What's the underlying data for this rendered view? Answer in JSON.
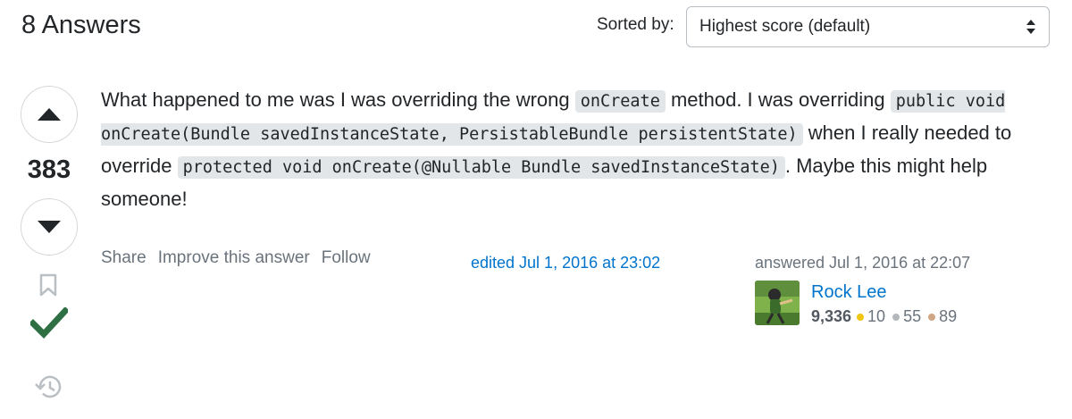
{
  "header": {
    "answers_title": "8 Answers",
    "sort_label": "Sorted by:",
    "sort_selected": "Highest score (default)"
  },
  "votes": {
    "score": "383"
  },
  "answer": {
    "t1": "What happened to me was I was overriding the wrong ",
    "c1": "onCreate",
    "t2": " method. I was overriding ",
    "c2": "public void onCreate(Bundle savedInstanceState, PersistableBundle persistentState)",
    "t3": " when I really needed to override ",
    "c3": "protected void onCreate(@Nullable Bundle savedInstanceState)",
    "t4": ". Maybe this might help someone!"
  },
  "menu": {
    "share": "Share",
    "improve": "Improve this answer",
    "follow": "Follow"
  },
  "edited": "edited Jul 1, 2016 at 23:02",
  "answered": "answered Jul 1, 2016 at 22:07",
  "user": {
    "name": "Rock Lee",
    "reputation": "9,336",
    "gold": "10",
    "silver": "55",
    "bronze": "89"
  },
  "colors": {
    "accent_link": "#0074cc",
    "accepted_green": "#2f6f44",
    "gold": "#f1c40f",
    "silver": "#b4b8bc",
    "bronze": "#d1a684"
  },
  "icons": [
    "chevron-up-icon",
    "chevron-down-icon",
    "bookmark-icon",
    "checkmark-icon",
    "history-icon",
    "sort-arrows-icon"
  ]
}
